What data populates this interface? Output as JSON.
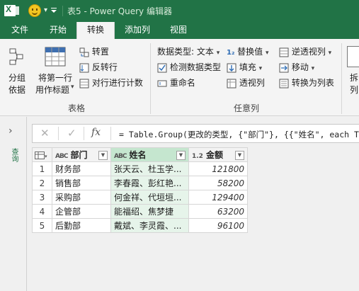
{
  "window": {
    "title": "表5 - Power Query 编辑器",
    "brand_color": "#217346"
  },
  "ribbon_tabs": [
    {
      "label": "文件",
      "active": false
    },
    {
      "label": "开始",
      "active": false
    },
    {
      "label": "转换",
      "active": true
    },
    {
      "label": "添加列",
      "active": false
    },
    {
      "label": "视图",
      "active": false
    }
  ],
  "ribbon": {
    "table_group": {
      "label": "表格",
      "group_by": "分组\n依据",
      "group_by_line1": "分组",
      "group_by_line2": "依据",
      "use_first_row_line1": "将第一行",
      "use_first_row_line2": "用作标题",
      "transpose": "转置",
      "reverse_rows": "反转行",
      "count_rows": "对行进行计数"
    },
    "any_column_group": {
      "label": "任意列",
      "data_type": "数据类型: 文本",
      "detect_type": "检测数据类型",
      "rename": "重命名",
      "replace_values": "替换值",
      "fill": "填充",
      "pivot_column": "透视列",
      "unpivot_columns": "逆透视列",
      "move": "移动",
      "convert_to_list": "转换为列表"
    },
    "split_partial": "拆\n列",
    "split_partial_1": "拆",
    "split_partial_2": "列"
  },
  "left_pane": {
    "label": "查询"
  },
  "formula_bar": {
    "cancel_icon": "close-icon",
    "confirm_icon": "check-icon",
    "fx_label": "fx",
    "formula": "= Table.Group(更改的类型, {\"部门\"}, {{\"姓名\", each Te"
  },
  "table": {
    "columns": [
      {
        "type_label": "ABC",
        "name": "部门",
        "selected": false
      },
      {
        "type_label": "ABC",
        "name": "姓名",
        "selected": true
      },
      {
        "type_label": "1.2",
        "name": "金额",
        "selected": false
      }
    ],
    "rows": [
      {
        "n": "1",
        "dept": "财务部",
        "name": "张天云、杜玉学...",
        "amount": "121800"
      },
      {
        "n": "2",
        "dept": "销售部",
        "name": "李春霞、彭红艳...",
        "amount": "58200"
      },
      {
        "n": "3",
        "dept": "采购部",
        "name": "何金祥、代垣垣...",
        "amount": "129400"
      },
      {
        "n": "4",
        "dept": "企管部",
        "name": "能福绍、焦梦捷",
        "amount": "63200"
      },
      {
        "n": "5",
        "dept": "后勤部",
        "name": "戴斌、李灵霞、...",
        "amount": "96100"
      }
    ]
  }
}
